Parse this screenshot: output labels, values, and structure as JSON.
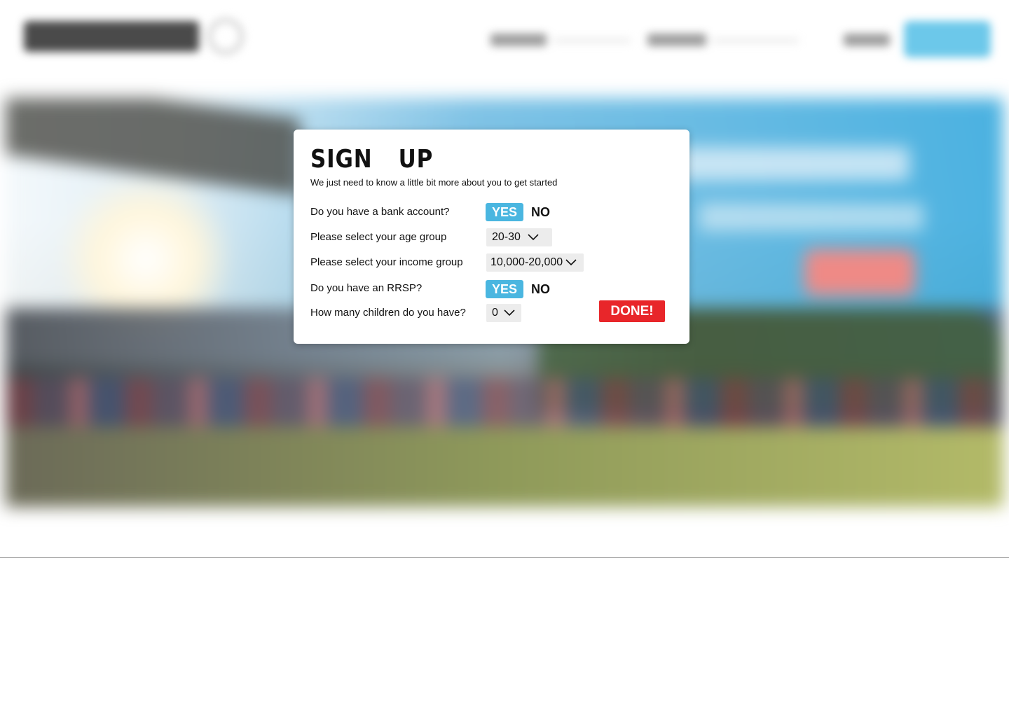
{
  "modal": {
    "title": "SIGN  UP",
    "subtitle": "We just need to know a little bit more about you to get started",
    "questions": [
      {
        "label": "Do you have a bank account?",
        "type": "yes-no",
        "yes_label": "YES",
        "no_label": "NO",
        "selected": "YES"
      },
      {
        "label": "Please select your age group",
        "type": "select",
        "value": "20-30"
      },
      {
        "label": "Please select your income group",
        "type": "select",
        "value": "10,000-20,000"
      },
      {
        "label": "Do you have an RRSP?",
        "type": "yes-no",
        "yes_label": "YES",
        "no_label": "NO",
        "selected": "YES"
      },
      {
        "label": "How many children do you have?",
        "type": "select",
        "value": "0"
      }
    ],
    "done_label": "DONE!"
  },
  "colors": {
    "accent_blue": "#4ab6e0",
    "done_red": "#e8262a",
    "select_bg": "#ececec"
  },
  "icons": {
    "dropdown": "chevron-down-icon"
  }
}
